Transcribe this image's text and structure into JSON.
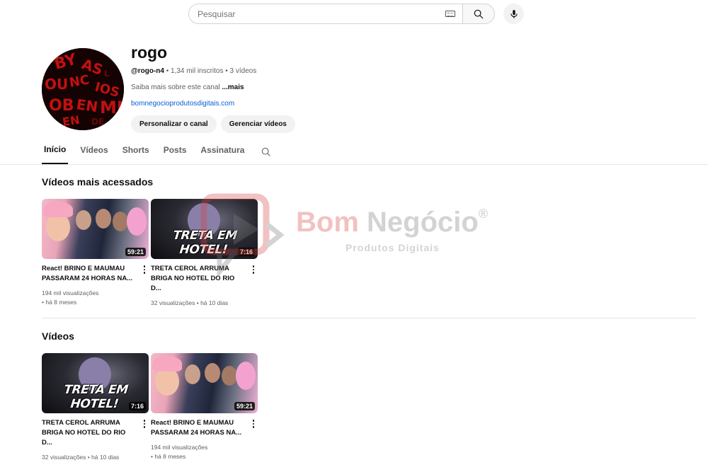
{
  "search": {
    "placeholder": "Pesquisar"
  },
  "icons": {
    "keyboard": "keyboard-icon",
    "search": "search-icon",
    "mic": "mic-icon",
    "kebab": "more-vert-icon"
  },
  "channel": {
    "name": "rogo",
    "handle": "@rogo-n4",
    "meta": " • 1,34 mil inscritos • 3 vídeos",
    "about": "Saiba mais sobre este canal ",
    "about_more": "...mais",
    "link": "bomnegocioprodutosdigitais.com",
    "avatar_text": "BYASOUNCIOSOBENMI",
    "buttons": {
      "customize": "Personalizar o canal",
      "manage": "Gerenciar vídeos"
    }
  },
  "tabs": [
    "Início",
    "Vídeos",
    "Shorts",
    "Posts",
    "Assinatura"
  ],
  "sections": {
    "popular_title": "Vídeos mais acessados",
    "videos_title": "Vídeos",
    "popular": [
      {
        "title": "React! BRINO E MAUMAU PASSARAM 24 HORAS NA...",
        "duration": "59:21",
        "views": "194 mil visualizações",
        "age": "• há 8 meses"
      },
      {
        "title": "TRETA CEROL ARRUMA BRIGA NO HOTEL DO RIO D...",
        "duration": "7:16",
        "views": "32 visualizações",
        "age": " • há 10 dias",
        "thumb_text": "TRETA EM HOTEL!"
      }
    ],
    "videos": [
      {
        "title": "TRETA CEROL ARRUMA BRIGA NO HOTEL DO RIO D...",
        "duration": "7:16",
        "views": "32 visualizações",
        "age": " • há 10 dias",
        "thumb_text": "TRETA EM HOTEL!"
      },
      {
        "title": "React! BRINO E MAUMAU PASSARAM 24 HORAS NA...",
        "duration": "59:21",
        "views": "194 mil visualizações",
        "age": "• há 8 meses"
      }
    ]
  },
  "watermark": {
    "brand_a": "Bom",
    "brand_b": "Negócio",
    "reg": "®",
    "sub": "Produtos Digitais"
  },
  "colors": {
    "link": "#065fd4",
    "accent_red": "#d94040",
    "avatar_bg": "#150202"
  }
}
